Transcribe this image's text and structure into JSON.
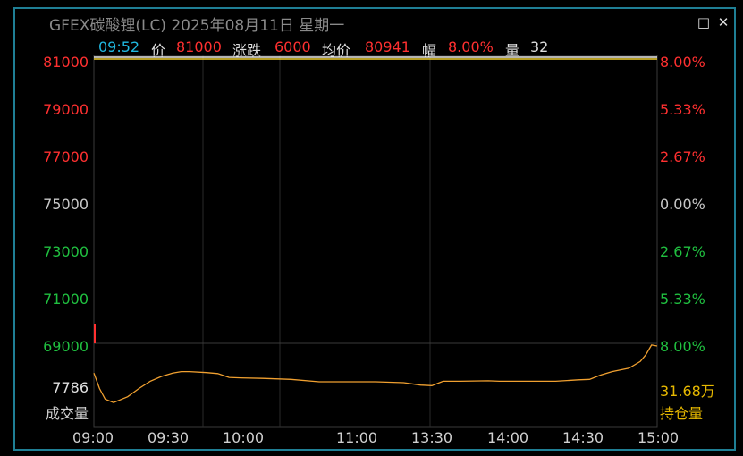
{
  "window": {
    "title": "GFEX碳酸锂(LC) 2025年08月11日 星期一"
  },
  "info_bar": {
    "time": "09:52",
    "price_label": "价",
    "price": "81000",
    "change_label": "涨跌",
    "change": "6000",
    "avg_label": "均价",
    "avg": "80941",
    "pct_label": "幅",
    "pct": "8.00%",
    "vol_label": "量",
    "vol": "32"
  },
  "chart_data": {
    "type": "line",
    "title": "",
    "y_ticks": [
      "81000",
      "79000",
      "77000",
      "75000",
      "73000",
      "71000",
      "69000"
    ],
    "y_colors": [
      "#ff3030",
      "#ff3030",
      "#ff3030",
      "#c8c8c8",
      "#20c040",
      "#20c040",
      "#20c040"
    ],
    "pct_ticks": [
      "8.00%",
      "5.33%",
      "2.67%",
      "0.00%",
      "2.67%",
      "5.33%",
      "8.00%"
    ],
    "x_ticks": [
      "09:00",
      "09:30",
      "10:00",
      "11:00",
      "13:30",
      "14:00",
      "14:30",
      "15:00"
    ],
    "ylim": [
      69000,
      81000
    ],
    "price_series": {
      "x": [
        0.0,
        0.02
      ],
      "y": [
        81000,
        81000
      ]
    },
    "open_interest": {
      "left_label": "7786",
      "right_label": "31.68万",
      "left_caption": "成交量",
      "right_caption": "持仓量",
      "x": [
        0,
        0.01,
        0.02,
        0.035,
        0.06,
        0.08,
        0.1,
        0.12,
        0.14,
        0.155,
        0.17,
        0.2,
        0.22,
        0.24,
        0.26,
        0.3,
        0.35,
        0.4,
        0.45,
        0.5,
        0.55,
        0.58,
        0.6,
        0.62,
        0.65,
        0.7,
        0.72,
        0.75,
        0.78,
        0.82,
        0.86,
        0.88,
        0.9,
        0.92,
        0.95,
        0.97,
        0.98,
        0.99,
        1.0
      ],
      "y": [
        0.94,
        0.62,
        0.4,
        0.33,
        0.45,
        0.62,
        0.77,
        0.87,
        0.94,
        0.97,
        0.97,
        0.95,
        0.93,
        0.85,
        0.84,
        0.83,
        0.81,
        0.76,
        0.76,
        0.76,
        0.74,
        0.69,
        0.68,
        0.77,
        0.77,
        0.78,
        0.77,
        0.77,
        0.77,
        0.77,
        0.8,
        0.81,
        0.9,
        0.97,
        1.04,
        1.18,
        1.32,
        1.52,
        1.5
      ]
    },
    "colors": {
      "price_line": "#f0f0f0",
      "avg_line": "#f0d030",
      "oi_line": "#f0a030",
      "grid": "#2a2a2a",
      "axis": "#3a3a3a"
    }
  },
  "colors": {
    "border": "#1f7f95",
    "up": "#ff3030",
    "down": "#20c040",
    "neutral": "#c8c8c8",
    "time": "#20b8e0",
    "gold": "#e6b800"
  }
}
